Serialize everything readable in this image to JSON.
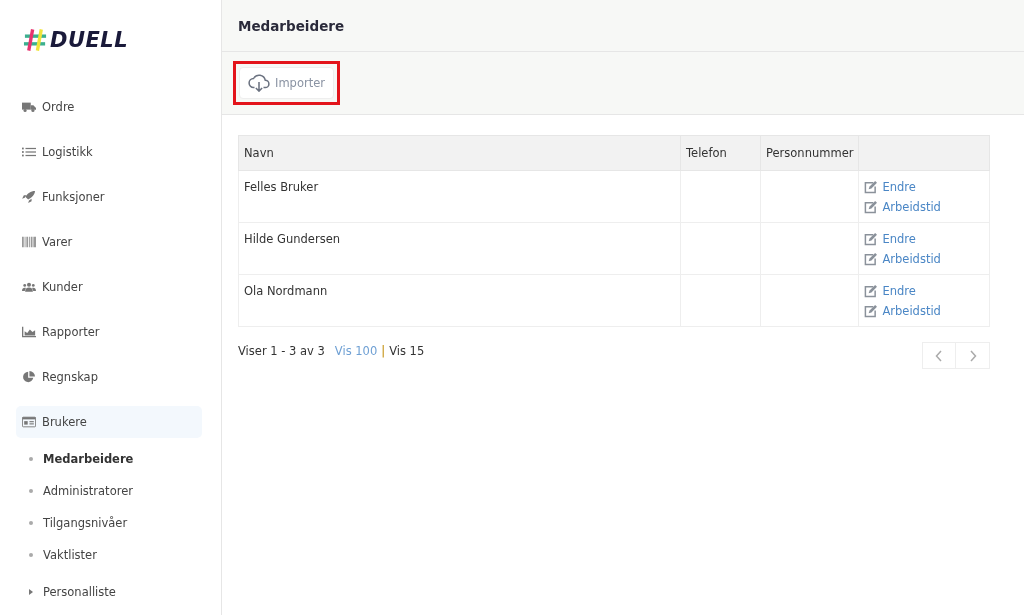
{
  "logo": {
    "text": "DUELL"
  },
  "sidebar": {
    "items": [
      {
        "label": "Ordre",
        "selected": false
      },
      {
        "label": "Logistikk",
        "selected": false
      },
      {
        "label": "Funksjoner",
        "selected": false
      },
      {
        "label": "Varer",
        "selected": false
      },
      {
        "label": "Kunder",
        "selected": false
      },
      {
        "label": "Rapporter",
        "selected": false
      },
      {
        "label": "Regnskap",
        "selected": false
      },
      {
        "label": "Brukere",
        "selected": true,
        "children": [
          {
            "label": "Medarbeidere",
            "kind": "link",
            "selected": true
          },
          {
            "label": "Administratorer",
            "kind": "link",
            "selected": false
          },
          {
            "label": "Tilgangsnivåer",
            "kind": "link",
            "selected": false
          },
          {
            "label": "Vaktlister",
            "kind": "link",
            "selected": false
          },
          {
            "label": "Personalliste",
            "kind": "group",
            "selected": false
          }
        ]
      }
    ]
  },
  "page": {
    "title": "Medarbeidere"
  },
  "toolbar": {
    "import_button": {
      "label": "Importer",
      "highlighted": true
    }
  },
  "table": {
    "columns": [
      "Navn",
      "Telefon",
      "Personnummer"
    ],
    "rows": [
      {
        "name": "Felles Bruker",
        "actions": [
          "Endre",
          "Arbeidstid"
        ]
      },
      {
        "name": "Hilde Gundersen",
        "actions": [
          "Endre",
          "Arbeidstid"
        ]
      },
      {
        "name": "Ola Nordmann",
        "actions": [
          "Endre",
          "Arbeidstid"
        ]
      }
    ]
  },
  "pagination": {
    "summary": "Viser 1 - 3 av 3",
    "page_sizes": [
      {
        "label": "Vis 100",
        "selected": false
      },
      {
        "label": "Vis 15",
        "selected": true
      }
    ],
    "separator": "|"
  }
}
